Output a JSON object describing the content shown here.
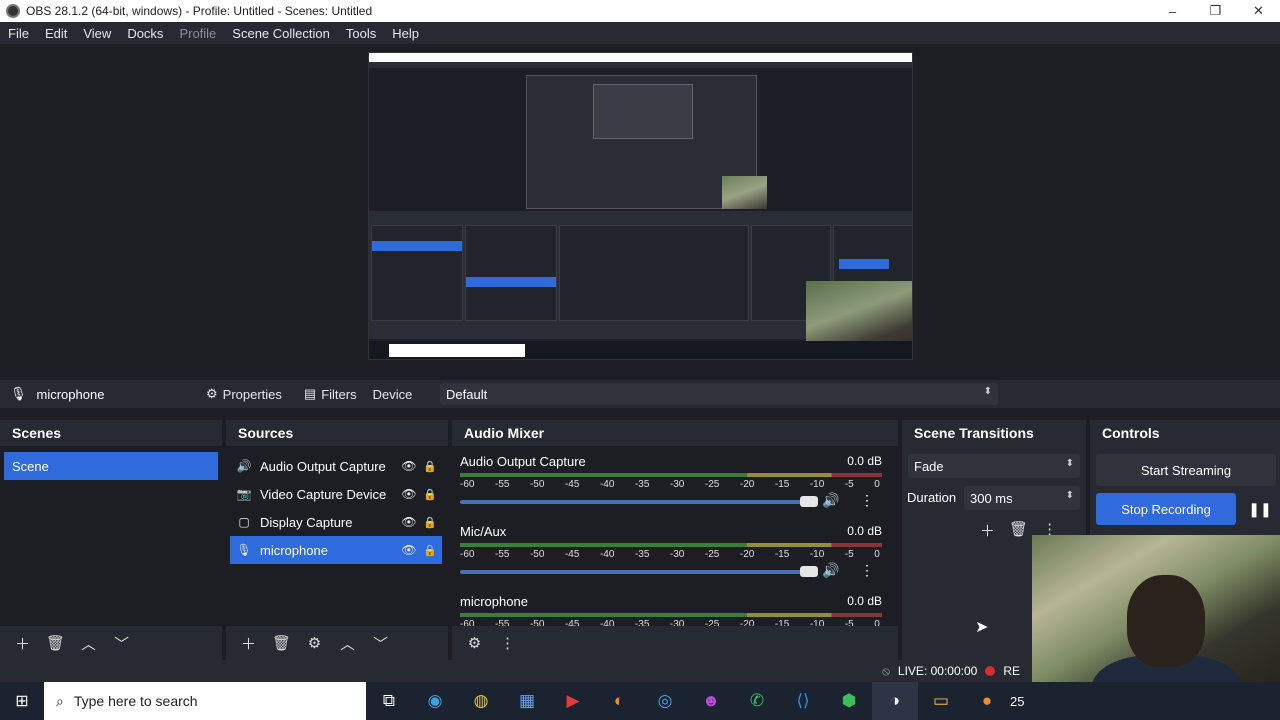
{
  "window": {
    "title": "OBS 28.1.2 (64-bit, windows) - Profile: Untitled - Scenes: Untitled",
    "minimize": "–",
    "restore": "❐",
    "close": "✕"
  },
  "menu": {
    "file": "File",
    "edit": "Edit",
    "view": "View",
    "docks": "Docks",
    "profile": "Profile",
    "scene_collection": "Scene Collection",
    "tools": "Tools",
    "help": "Help"
  },
  "properties_bar": {
    "source_name": "microphone",
    "properties_label": "Properties",
    "filters_label": "Filters",
    "device_label": "Device",
    "device_value": "Default"
  },
  "scenes": {
    "title": "Scenes",
    "items": [
      "Scene"
    ]
  },
  "sources": {
    "title": "Sources",
    "items": [
      {
        "label": "Audio Output Capture",
        "icon": "speaker-icon"
      },
      {
        "label": "Video Capture Device",
        "icon": "camera-icon"
      },
      {
        "label": "Display Capture",
        "icon": "monitor-icon"
      },
      {
        "label": "microphone",
        "icon": "microphone-icon",
        "selected": true
      }
    ]
  },
  "mixer": {
    "title": "Audio Mixer",
    "ticks": [
      "-60",
      "-55",
      "-50",
      "-45",
      "-40",
      "-35",
      "-30",
      "-25",
      "-20",
      "-15",
      "-10",
      "-5",
      "0"
    ],
    "channels": [
      {
        "name": "Audio Output Capture",
        "db": "0.0 dB",
        "volume": 0.95
      },
      {
        "name": "Mic/Aux",
        "db": "0.0 dB",
        "volume": 0.95
      },
      {
        "name": "microphone",
        "db": "0.0 dB"
      }
    ]
  },
  "transitions": {
    "title": "Scene Transitions",
    "selected": "Fade",
    "duration_label": "Duration",
    "duration_value": "300 ms"
  },
  "controls": {
    "title": "Controls",
    "start_streaming": "Start Streaming",
    "stop_recording": "Stop Recording"
  },
  "status": {
    "live": "LIVE: 00:00:00",
    "rec": "RE"
  },
  "taskbar": {
    "search_placeholder": "Type here to search",
    "tray_text": "25"
  },
  "colors": {
    "accent": "#2f6bdc",
    "dock_bg": "#272a33",
    "panel_bg": "#1d1e24",
    "record_dot": "#d52f2f"
  }
}
